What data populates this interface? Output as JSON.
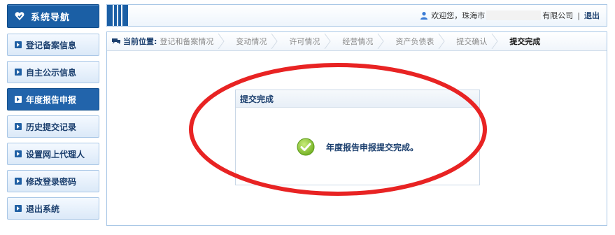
{
  "sidebar": {
    "title": "系统导航",
    "items": [
      {
        "label": "登记备案信息",
        "active": false
      },
      {
        "label": "自主公示信息",
        "active": false
      },
      {
        "label": "年度报告申报",
        "active": true
      },
      {
        "label": "历史提交记录",
        "active": false
      },
      {
        "label": "设置网上代理人",
        "active": false
      },
      {
        "label": "修改登录密码",
        "active": false
      },
      {
        "label": "退出系统",
        "active": false
      }
    ]
  },
  "header": {
    "welcome_prefix": "欢迎您，珠海市",
    "welcome_suffix": "有限公司",
    "separator": "|",
    "logout_label": "退出"
  },
  "breadcrumb": {
    "label": "当前位置:",
    "steps": [
      "登记和备案情况",
      "变动情况",
      "许可情况",
      "经营情况",
      "资产负债表",
      "提交确认",
      "提交完成"
    ],
    "current_step": "提交完成"
  },
  "result": {
    "panel_title": "提交完成",
    "message": "年度报告申报提交完成。"
  },
  "colors": {
    "primary": "#1b5fa5",
    "border": "#a9c7e6",
    "success": "#8cc63f",
    "annotation": "#e82323"
  },
  "icons": {
    "nav_logo": "heart-shield-icon",
    "user": "user-icon",
    "breadcrumb": "location-pin-icon",
    "success": "checkmark-circle-icon",
    "nav_bullet": "arrow-square-icon"
  }
}
